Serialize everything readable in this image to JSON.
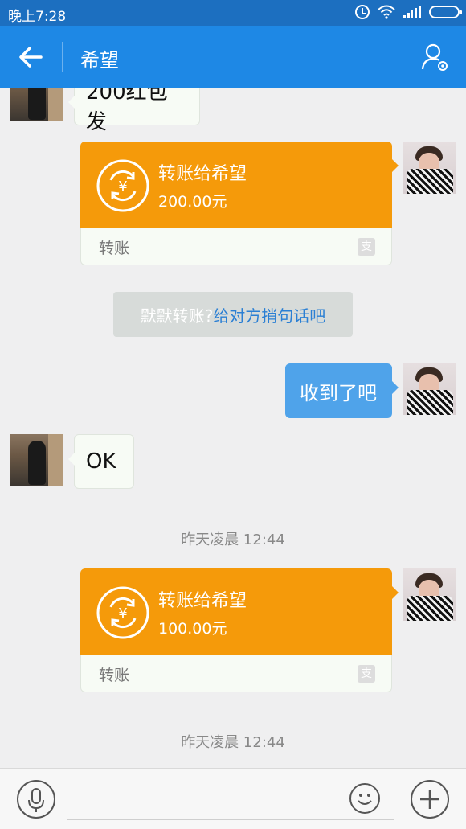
{
  "status_bar": {
    "time": "晚上7:28",
    "icons": [
      "alarm-icon",
      "wifi-icon",
      "signal-icon",
      "battery-icon"
    ]
  },
  "header": {
    "title": "希望",
    "back_icon": "arrow-left-icon",
    "settings_icon": "profile-settings-icon"
  },
  "messages": {
    "incoming_1": "200红包 发",
    "transfer_1": {
      "title": "转账给希望",
      "amount": "200.00元",
      "type": "转账"
    },
    "system": {
      "prompt": "默默转账?",
      "action": "给对方捎句话吧"
    },
    "outgoing_1": "收到了吧",
    "incoming_2": "OK",
    "timestamp_1": "昨天凌晨 12:44",
    "transfer_2": {
      "title": "转账给希望",
      "amount": "100.00元",
      "type": "转账"
    },
    "timestamp_2": "昨天凌晨 12:44"
  },
  "colors": {
    "header": "#1e88e5",
    "status_bar": "#1c6fc0",
    "transfer": "#f59a0a",
    "outgoing_bubble": "#4fa3ea",
    "link": "#2a7fd4"
  },
  "input_bar": {
    "icons": [
      "microphone-icon",
      "emoji-icon",
      "plus-icon"
    ]
  }
}
